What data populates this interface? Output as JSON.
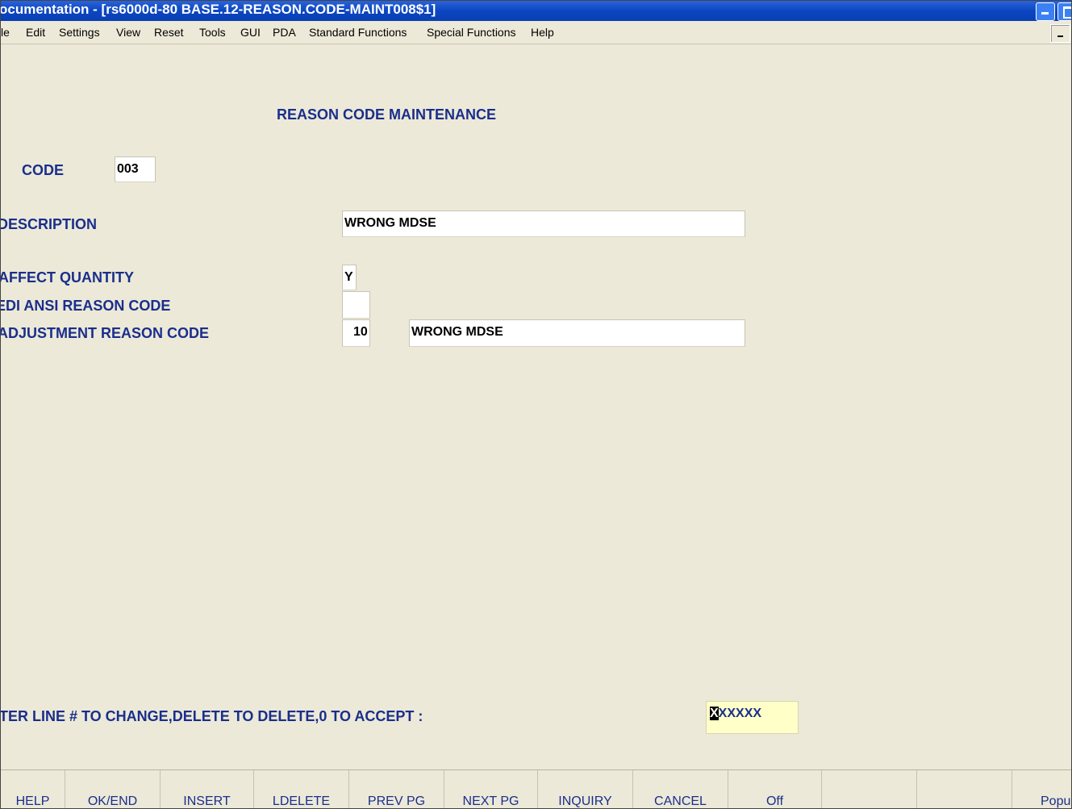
{
  "window": {
    "title": "ocumentation - [rs6000d-80 BASE.12-REASON.CODE-MAINT008$1]"
  },
  "menu": [
    "le",
    "Edit",
    "Settings",
    "View",
    "Reset",
    "Tools",
    "GUI",
    "PDA",
    "Standard Functions",
    "Special Functions",
    "Help"
  ],
  "screen": {
    "heading": "REASON CODE MAINTENANCE",
    "code_label": "CODE",
    "code_value": "003",
    "description_label": "DESCRIPTION",
    "description_value": "WRONG MDSE",
    "affect_quantity_label": "AFFECT QUANTITY",
    "affect_quantity_value": "Y",
    "edi_label": "EDI ANSI REASON CODE",
    "edi_value": "",
    "adjustment_label": "ADJUSTMENT REASON CODE",
    "adjustment_code": "10",
    "adjustment_desc": "WRONG MDSE",
    "prompt_text": "TER LINE # TO CHANGE,DELETE TO DELETE,0 TO ACCEPT :",
    "prompt_cursor": "X",
    "prompt_rest": "XXXXX"
  },
  "function_keys": [
    "HELP",
    "OK/END",
    "INSERT",
    "LDELETE",
    "PREV PG",
    "NEXT PG",
    "INQUIRY",
    "CANCEL",
    "Off",
    "",
    "",
    "Popup"
  ],
  "colors": {
    "label": "#1a2e8c",
    "background": "#ece9d8",
    "titlebar": "#0b46c2",
    "prompt_input_bg": "#ffffc8"
  }
}
